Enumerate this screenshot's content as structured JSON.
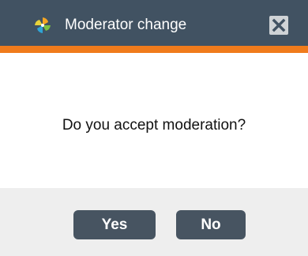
{
  "dialog": {
    "title": "Moderator change",
    "message": "Do you accept moderation?",
    "buttons": {
      "yes": "Yes",
      "no": "No"
    }
  },
  "icons": {
    "app": "pinwheel-logo-icon",
    "close": "close-icon"
  },
  "colors": {
    "titlebar": "#415262",
    "accent_stripe": "#f07b1c",
    "button": "#475461",
    "footer": "#eeeeee"
  }
}
